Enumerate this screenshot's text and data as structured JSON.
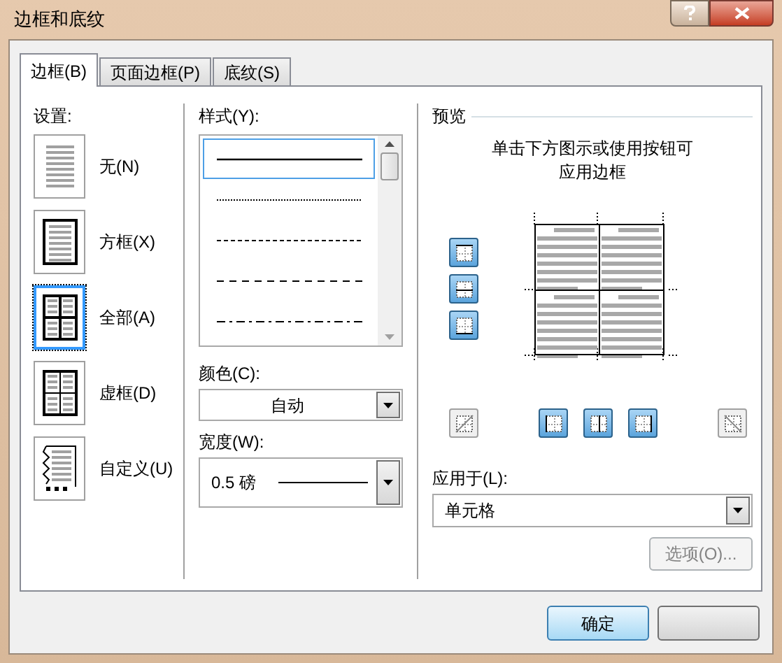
{
  "window": {
    "title": "边框和底纹"
  },
  "tabs": [
    {
      "label": "边框(B)",
      "selected": true
    },
    {
      "label": "页面边框(P)",
      "selected": false
    },
    {
      "label": "底纹(S)",
      "selected": false
    }
  ],
  "settings": {
    "label": "设置:",
    "items": [
      {
        "kind": "none",
        "label": "无(N)",
        "selected": false
      },
      {
        "kind": "box",
        "label": "方框(X)",
        "selected": false
      },
      {
        "kind": "all",
        "label": "全部(A)",
        "selected": true
      },
      {
        "kind": "grid",
        "label": "虚框(D)",
        "selected": false
      },
      {
        "kind": "custom",
        "label": "自定义(U)",
        "selected": false
      }
    ]
  },
  "style": {
    "label": "样式(Y):",
    "items": [
      {
        "kind": "solid",
        "selected": true
      },
      {
        "kind": "dotted",
        "selected": false
      },
      {
        "kind": "dashed",
        "selected": false
      },
      {
        "kind": "long_dash",
        "selected": false
      },
      {
        "kind": "dash_dot",
        "selected": false
      }
    ]
  },
  "color": {
    "label": "颜色(C):",
    "value": "自动"
  },
  "width": {
    "label": "宽度(W):",
    "value": "0.5 磅"
  },
  "preview": {
    "label": "预览",
    "hint": "单击下方图示或使用按钮可应用边框",
    "side_buttons": [
      {
        "kind": "top",
        "on": true
      },
      {
        "kind": "middle_h",
        "on": true
      },
      {
        "kind": "bottom",
        "on": true
      }
    ],
    "bottom_buttons": [
      {
        "kind": "diag_up",
        "on": false
      },
      {
        "kind": "left",
        "on": true
      },
      {
        "kind": "middle_v",
        "on": true
      },
      {
        "kind": "right",
        "on": true
      },
      {
        "kind": "diag_down",
        "on": false
      }
    ]
  },
  "apply_to": {
    "label": "应用于(L):",
    "value": "单元格"
  },
  "options_button": {
    "label": "选项(O)...",
    "disabled": true
  },
  "buttons": [
    {
      "label": "确定"
    }
  ]
}
